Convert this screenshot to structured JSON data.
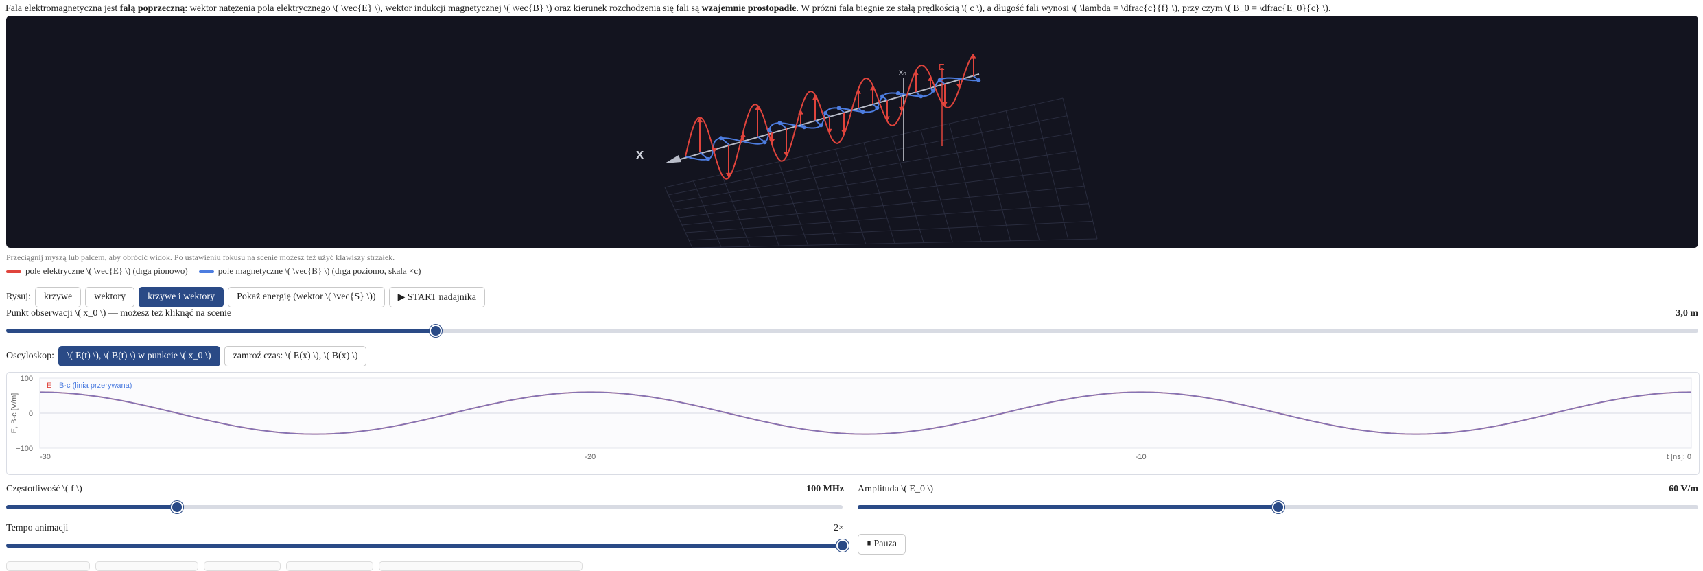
{
  "intro": {
    "p1": "Fala elektromagnetyczna jest ",
    "b1": "falą poprzeczną",
    "p2": ": wektor natężenia pola elektrycznego \\( \\vec{E} \\), wektor indukcji magnetycznej \\( \\vec{B} \\) oraz kierunek rozchodzenia się fali są ",
    "b2": "wzajemnie prostopadłe",
    "p3": ". W próżni fala biegnie ze stałą prędkością \\( c \\), a długość fali wynosi \\( \\lambda = \\dfrac{c}{f} \\), przy czym \\( B_0 = \\dfrac{E_0}{c} \\)."
  },
  "scene": {
    "axis_x": "x",
    "axis_x0": "x₀",
    "axis_e": "E",
    "e_color": "#e0443c",
    "b_color": "#4d7de0"
  },
  "hint": "Przeciągnij myszą lub palcem, aby obrócić widok. Po ustawieniu fokusu na scenie możesz też użyć klawiszy strzałek.",
  "legend": {
    "e_label": "pole elektryczne \\( \\vec{E} \\) (drga pionowo)",
    "b_label": "pole magnetyczne \\( \\vec{B} \\) (drga poziomo, skala ×c)"
  },
  "draw": {
    "label": "Rysuj:",
    "options": [
      "krzywe",
      "wektory",
      "krzywe i wektory"
    ],
    "selected": "krzywe i wektory",
    "energy": "Pokaż energię (wektor \\( \\vec{S} \\))",
    "start": "▶ START nadajnika"
  },
  "observation": {
    "label": "Punkt obserwacji \\( x_0 \\) — możesz też kliknąć na scenie",
    "value_text": "3,0 m",
    "fraction": 0.254
  },
  "oscilloscope": {
    "label": "Oscyloskop:",
    "mode_active": "\\( E(t) \\), \\( B(t) \\) w punkcie \\( x_0 \\)",
    "mode_other": "zamroź czas: \\( E(x) \\), \\( B(x) \\)",
    "legend_e": "E",
    "legend_b": "B·c (linia przerywana)",
    "y_axis_label": "E, B·c [V/m]",
    "y_ticks": [
      "100",
      "0",
      "−100"
    ],
    "x_ticks": [
      "-30",
      "-20",
      "-10"
    ],
    "x_end_label": "t [ns]: 0"
  },
  "chart_data": {
    "type": "line",
    "title": "",
    "xlabel": "t [ns]",
    "ylabel": "E, B·c [V/m]",
    "xlim": [
      -30,
      0
    ],
    "ylim": [
      -100,
      100
    ],
    "series": [
      {
        "name": "E",
        "amplitude": 60,
        "frequency_mhz": 100
      },
      {
        "name": "B·c (linia przerywana)",
        "amplitude": 60,
        "frequency_mhz": 100
      }
    ],
    "x": [
      -30,
      -27.5,
      -25,
      -22.5,
      -20,
      -17.5,
      -15,
      -12.5,
      -10,
      -7.5,
      -5,
      -2.5,
      0
    ],
    "y": [
      60,
      0,
      -60,
      0,
      60,
      0,
      -60,
      0,
      60,
      0,
      -60,
      0,
      60
    ]
  },
  "frequency": {
    "label": "Częstotliwość \\( f \\)",
    "value_text": "100 MHz",
    "fraction": 0.204
  },
  "amplitude": {
    "label": "Amplituda \\( E_0 \\)",
    "value_text": "60 V/m",
    "fraction": 0.5
  },
  "tempo": {
    "label": "Tempo animacji",
    "value_text": "2×",
    "fraction": 1.0
  },
  "pause": "⏸ Pauza"
}
